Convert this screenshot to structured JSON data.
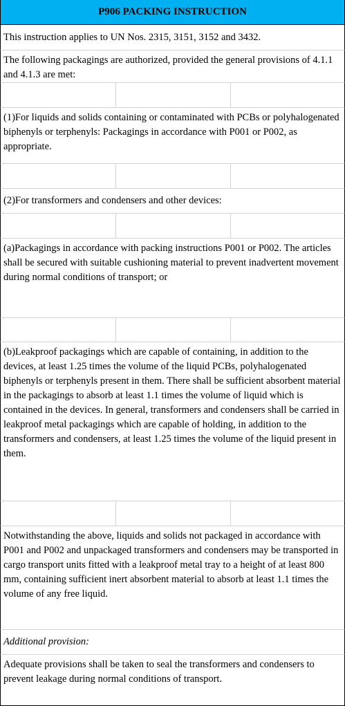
{
  "title": "P906 PACKING INSTRUCTION",
  "rows": {
    "applies": "This instruction applies to UN Nos. 2315, 3151, 3152 and 3432.",
    "authorized": "The following packagings are authorized, provided the general provisions of 4.1.1 and 4.1.3 are met:",
    "item1": "(1)For liquids and solids containing or contaminated with PCBs or polyhalogenated biphenyls or terphenyls: Packagings in accordance with P001 or P002, as appropriate.",
    "item2": "(2)For transformers and condensers and other devices:",
    "item2a": "(a)Packagings in accordance with packing instructions P001 or P002. The articles shall be secured with suitable cushioning material to prevent inadvertent movement during normal conditions of transport; or",
    "item2b": "(b)Leakproof packagings which are capable of containing, in addition to the devices, at least 1.25 times the volume of the liquid PCBs, polyhalogenated biphenyls or terphenyls present in them. There shall be sufficient absorbent material in the packagings to absorb at least 1.1 times the volume of liquid which is contained in the devices. In general, transformers and condensers shall be carried in leakproof metal packagings which are capable of holding, in addition to the transformers and condensers, at least 1.25 times the volume of the liquid present in them.",
    "notwithstanding": "Notwithstanding the above, liquids and solids not packaged in accordance with P001 and P002 and unpackaged transformers and condensers may be transported in cargo transport units fitted with a leakproof metal tray to a height of at least 800 mm, containing sufficient inert absorbent material to absorb at least 1.1 times the volume of any free liquid.",
    "additional_label": "Additional provision:",
    "additional_text": "Adequate provisions shall be taken to seal the transformers and condensers to prevent leakage during normal conditions of transport."
  }
}
